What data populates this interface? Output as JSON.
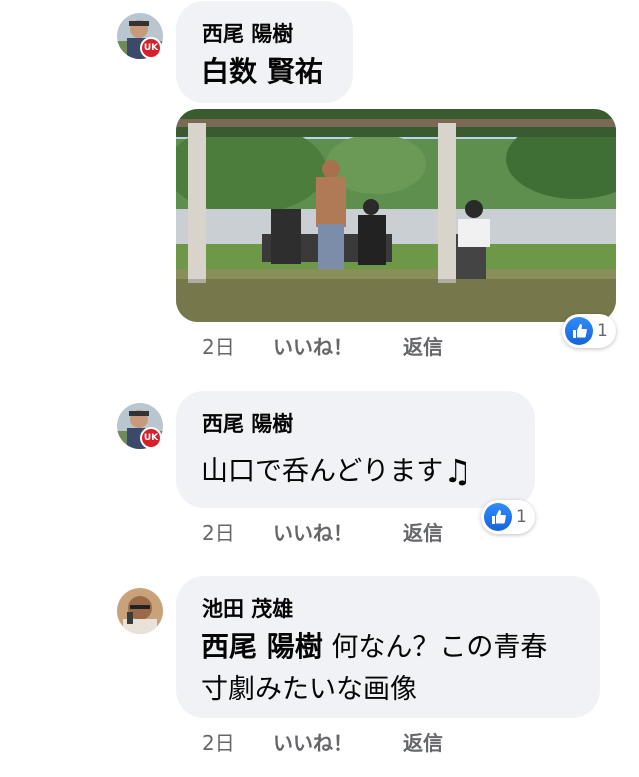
{
  "comments": [
    {
      "author": "西尾 陽樹",
      "text": "白数 賢祐",
      "time": "2日",
      "like_label": "いいね！",
      "reply_label": "返信",
      "reaction_count": "1",
      "reaction_icon": "like-icon"
    },
    {
      "author": "西尾 陽樹",
      "text": "山口で呑んどります",
      "emoji": "♫",
      "time": "2日",
      "like_label": "いいね！",
      "reply_label": "返信",
      "reaction_count": "1",
      "reaction_icon": "like-icon"
    },
    {
      "author": "池田 茂雄",
      "mention": "西尾 陽樹",
      "text_line1": "何なん？この青春",
      "text_line2": "寸劇みたいな画像",
      "time": "2日",
      "like_label": "いいね！",
      "reply_label": "返信"
    }
  ],
  "colors": {
    "bubble": "#f0f2f5",
    "meta_text": "#65676b",
    "like_blue": "#1877f2"
  }
}
